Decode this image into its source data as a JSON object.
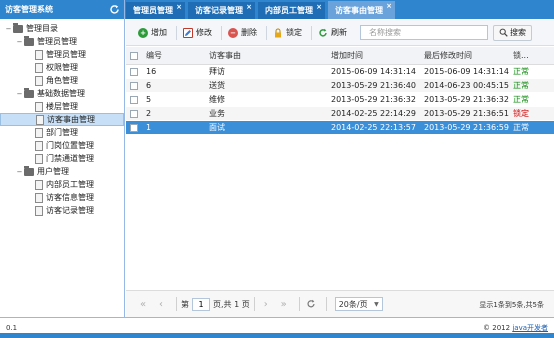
{
  "app": {
    "title": "访客管理系统"
  },
  "tree": [
    {
      "label": "管理目录",
      "level": 0,
      "type": "folder",
      "expander": "−",
      "selected": false
    },
    {
      "label": "管理员管理",
      "level": 1,
      "type": "folder",
      "expander": "−",
      "selected": false
    },
    {
      "label": "管理员管理",
      "level": 2,
      "type": "file",
      "expander": "",
      "selected": false
    },
    {
      "label": "权限管理",
      "level": 2,
      "type": "file",
      "expander": "",
      "selected": false
    },
    {
      "label": "角色管理",
      "level": 2,
      "type": "file",
      "expander": "",
      "selected": false
    },
    {
      "label": "基础数据管理",
      "level": 1,
      "type": "folder",
      "expander": "−",
      "selected": false
    },
    {
      "label": "楼层管理",
      "level": 2,
      "type": "file",
      "expander": "",
      "selected": false
    },
    {
      "label": "访客事由管理",
      "level": 2,
      "type": "file",
      "expander": "",
      "selected": true
    },
    {
      "label": "部门管理",
      "level": 2,
      "type": "file",
      "expander": "",
      "selected": false
    },
    {
      "label": "门岗位置管理",
      "level": 2,
      "type": "file",
      "expander": "",
      "selected": false
    },
    {
      "label": "门禁通道管理",
      "level": 2,
      "type": "file",
      "expander": "",
      "selected": false
    },
    {
      "label": "用户管理",
      "level": 1,
      "type": "folder",
      "expander": "−",
      "selected": false
    },
    {
      "label": "内部员工管理",
      "level": 2,
      "type": "file",
      "expander": "",
      "selected": false
    },
    {
      "label": "访客信息管理",
      "level": 2,
      "type": "file",
      "expander": "",
      "selected": false
    },
    {
      "label": "访客记录管理",
      "level": 2,
      "type": "file",
      "expander": "",
      "selected": false
    }
  ],
  "tabs": [
    {
      "label": "管理员管理",
      "active": false
    },
    {
      "label": "访客记录管理",
      "active": false
    },
    {
      "label": "内部员工管理",
      "active": false
    },
    {
      "label": "访客事由管理",
      "active": true
    }
  ],
  "toolbar": {
    "add_label": "增加",
    "edit_label": "修改",
    "delete_label": "删除",
    "lock_label": "锁定",
    "refresh_label": "刷新",
    "search_placeholder": "名称搜索",
    "search_label": "搜索",
    "colors": {
      "add": "#2e9b3b",
      "edit": "#c0392b",
      "delete": "#d9534f",
      "lock": "#e6a817",
      "refresh": "#2e9b3b"
    }
  },
  "grid": {
    "columns": {
      "id": "编号",
      "name": "访客事由",
      "added": "增加时间",
      "modified": "最后修改时间",
      "lock": "锁..."
    },
    "rows": [
      {
        "id": "16",
        "name": "拜访",
        "added": "2015-06-09 14:31:14",
        "modified": "2015-06-09 14:31:14",
        "status": "正常",
        "status_kind": "ok"
      },
      {
        "id": "6",
        "name": "送货",
        "added": "2013-05-29 21:36:40",
        "modified": "2014-06-23 00:45:15",
        "status": "正常",
        "status_kind": "ok"
      },
      {
        "id": "5",
        "name": "维修",
        "added": "2013-05-29 21:36:32",
        "modified": "2013-05-29 21:36:32",
        "status": "正常",
        "status_kind": "ok"
      },
      {
        "id": "2",
        "name": "业务",
        "added": "2014-02-25 22:14:29",
        "modified": "2013-05-29 21:36:51",
        "status": "锁定",
        "status_kind": "lock"
      },
      {
        "id": "1",
        "name": "面试",
        "added": "2014-02-25 22:13:57",
        "modified": "2013-05-29 21:36:59",
        "status": "正常",
        "status_kind": "ok",
        "selected": true
      }
    ]
  },
  "pager": {
    "page_prefix": "第",
    "page_value": "1",
    "page_suffix": "页,共 1 页",
    "page_size": "20条/页",
    "info": "显示1条到5条,共5条"
  },
  "footer": {
    "version": "0.1",
    "copyright_prefix": "© 2012",
    "copyright_link": "java开发者"
  }
}
